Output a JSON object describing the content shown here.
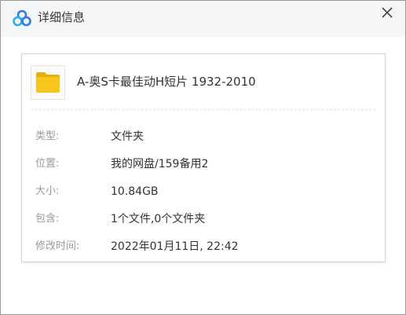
{
  "titlebar": {
    "title": "详细信息",
    "app_icon": "baidu-netdisk-cloud-icon",
    "close_icon": "close-icon"
  },
  "file": {
    "icon": "folder-icon",
    "name": "A-奥S卡最佳动H短片 1932-2010"
  },
  "properties": [
    {
      "label": "类型:",
      "value": "文件夹"
    },
    {
      "label": "位置:",
      "value": "我的网盘/159备用2"
    },
    {
      "label": "大小:",
      "value": "10.84GB"
    },
    {
      "label": "包含:",
      "value": "1个文件,0个文件夹"
    },
    {
      "label": "修改时间:",
      "value": "2022年01月11日, 22:42"
    }
  ],
  "colors": {
    "titlebar_bg": "#f5f6f8",
    "folder_yellow": "#f8c51c",
    "logo_blue": "#2f7bef",
    "label_gray": "#9a9a9a",
    "text_dark": "#333333"
  }
}
